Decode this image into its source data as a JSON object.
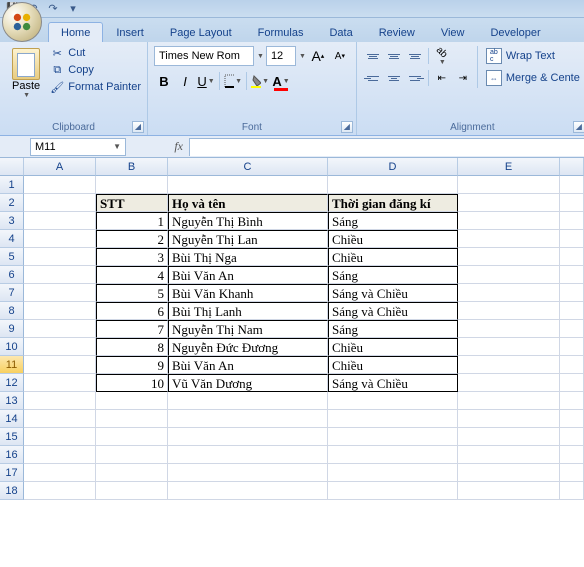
{
  "qat": {
    "save": "💾",
    "undo": "↶",
    "redo": "↷"
  },
  "tabs": {
    "home": "Home",
    "insert": "Insert",
    "page_layout": "Page Layout",
    "formulas": "Formulas",
    "data": "Data",
    "review": "Review",
    "view": "View",
    "developer": "Developer"
  },
  "ribbon": {
    "clipboard": {
      "paste": "Paste",
      "cut": "Cut",
      "copy": "Copy",
      "format_painter": "Format Painter",
      "label": "Clipboard"
    },
    "font": {
      "name": "Times New Rom",
      "size": "12",
      "bold": "B",
      "italic": "I",
      "underline": "U",
      "grow": "A",
      "grow_sup": "▴",
      "shrink": "A",
      "shrink_sup": "▾",
      "label": "Font"
    },
    "alignment": {
      "wrap_text": "Wrap Text",
      "merge_center": "Merge & Cente",
      "label": "Alignment"
    }
  },
  "namebox": "M11",
  "fx": "fx",
  "columns": [
    "A",
    "B",
    "C",
    "D",
    "E",
    ""
  ],
  "rows": [
    "1",
    "2",
    "3",
    "4",
    "5",
    "6",
    "7",
    "8",
    "9",
    "10",
    "11",
    "12",
    "13",
    "14",
    "15",
    "16",
    "17",
    "18"
  ],
  "active_row": "11",
  "table": {
    "headers": {
      "stt": "STT",
      "name": "Họ và tên",
      "time": "Thời gian đăng kí"
    },
    "data": [
      {
        "stt": "1",
        "name": "Nguyễn Thị Bình",
        "time": "Sáng"
      },
      {
        "stt": "2",
        "name": "Nguyễn Thị Lan",
        "time": "Chiều"
      },
      {
        "stt": "3",
        "name": "Bùi Thị Nga",
        "time": "Chiều"
      },
      {
        "stt": "4",
        "name": "Bùi Văn An",
        "time": "Sáng"
      },
      {
        "stt": "5",
        "name": "Bùi Văn Khanh",
        "time": "Sáng và Chiều"
      },
      {
        "stt": "6",
        "name": "Bùi Thị Lanh",
        "time": "Sáng và Chiều"
      },
      {
        "stt": "7",
        "name": "Nguyễn Thị Nam",
        "time": "Sáng"
      },
      {
        "stt": "8",
        "name": "Nguyễn Đức Đương",
        "time": "Chiều"
      },
      {
        "stt": "9",
        "name": "Bùi Văn An",
        "time": "Chiều"
      },
      {
        "stt": "10",
        "name": "Vũ Văn Dương",
        "time": "Sáng và Chiều"
      }
    ]
  }
}
